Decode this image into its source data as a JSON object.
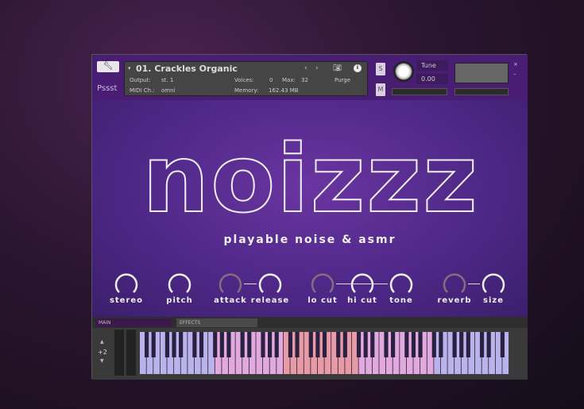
{
  "header": {
    "logo_text": "Pssst",
    "instrument": "01. Crackles Organic",
    "output_label": "Output:",
    "output_value": "st. 1",
    "midi_label": "MIDI Ch.:",
    "midi_value": "omni",
    "voices_label": "Voices:",
    "voices_value": "0",
    "max_label": "Max:",
    "max_value": "32",
    "memory_label": "Memory:",
    "memory_value": "162.43 MB",
    "purge": "Purge",
    "solo": "S",
    "mute": "M",
    "tune_label": "Tune",
    "tune_value": "0.00"
  },
  "main": {
    "title": "noizzz",
    "tagline": "playable noise & asmr",
    "knobs": [
      {
        "label": "stereo",
        "active": true
      },
      {
        "label": "pitch",
        "active": true
      },
      {
        "label": "attack",
        "active": false
      },
      {
        "label": "release",
        "active": true
      },
      {
        "label": "lo cut",
        "active": false
      },
      {
        "label": "hi cut",
        "active": true
      },
      {
        "label": "tone",
        "active": true
      },
      {
        "label": "reverb",
        "active": false
      },
      {
        "label": "size",
        "active": true
      }
    ]
  },
  "tabs": [
    "MAIN",
    "EFFECTS"
  ],
  "keyboard": {
    "octave": "+2"
  },
  "colors": {
    "accent": "#4a1d74",
    "key_blue": "#b9b2ec",
    "key_pink": "#e2a9e0",
    "key_red": "#e89aa8"
  }
}
